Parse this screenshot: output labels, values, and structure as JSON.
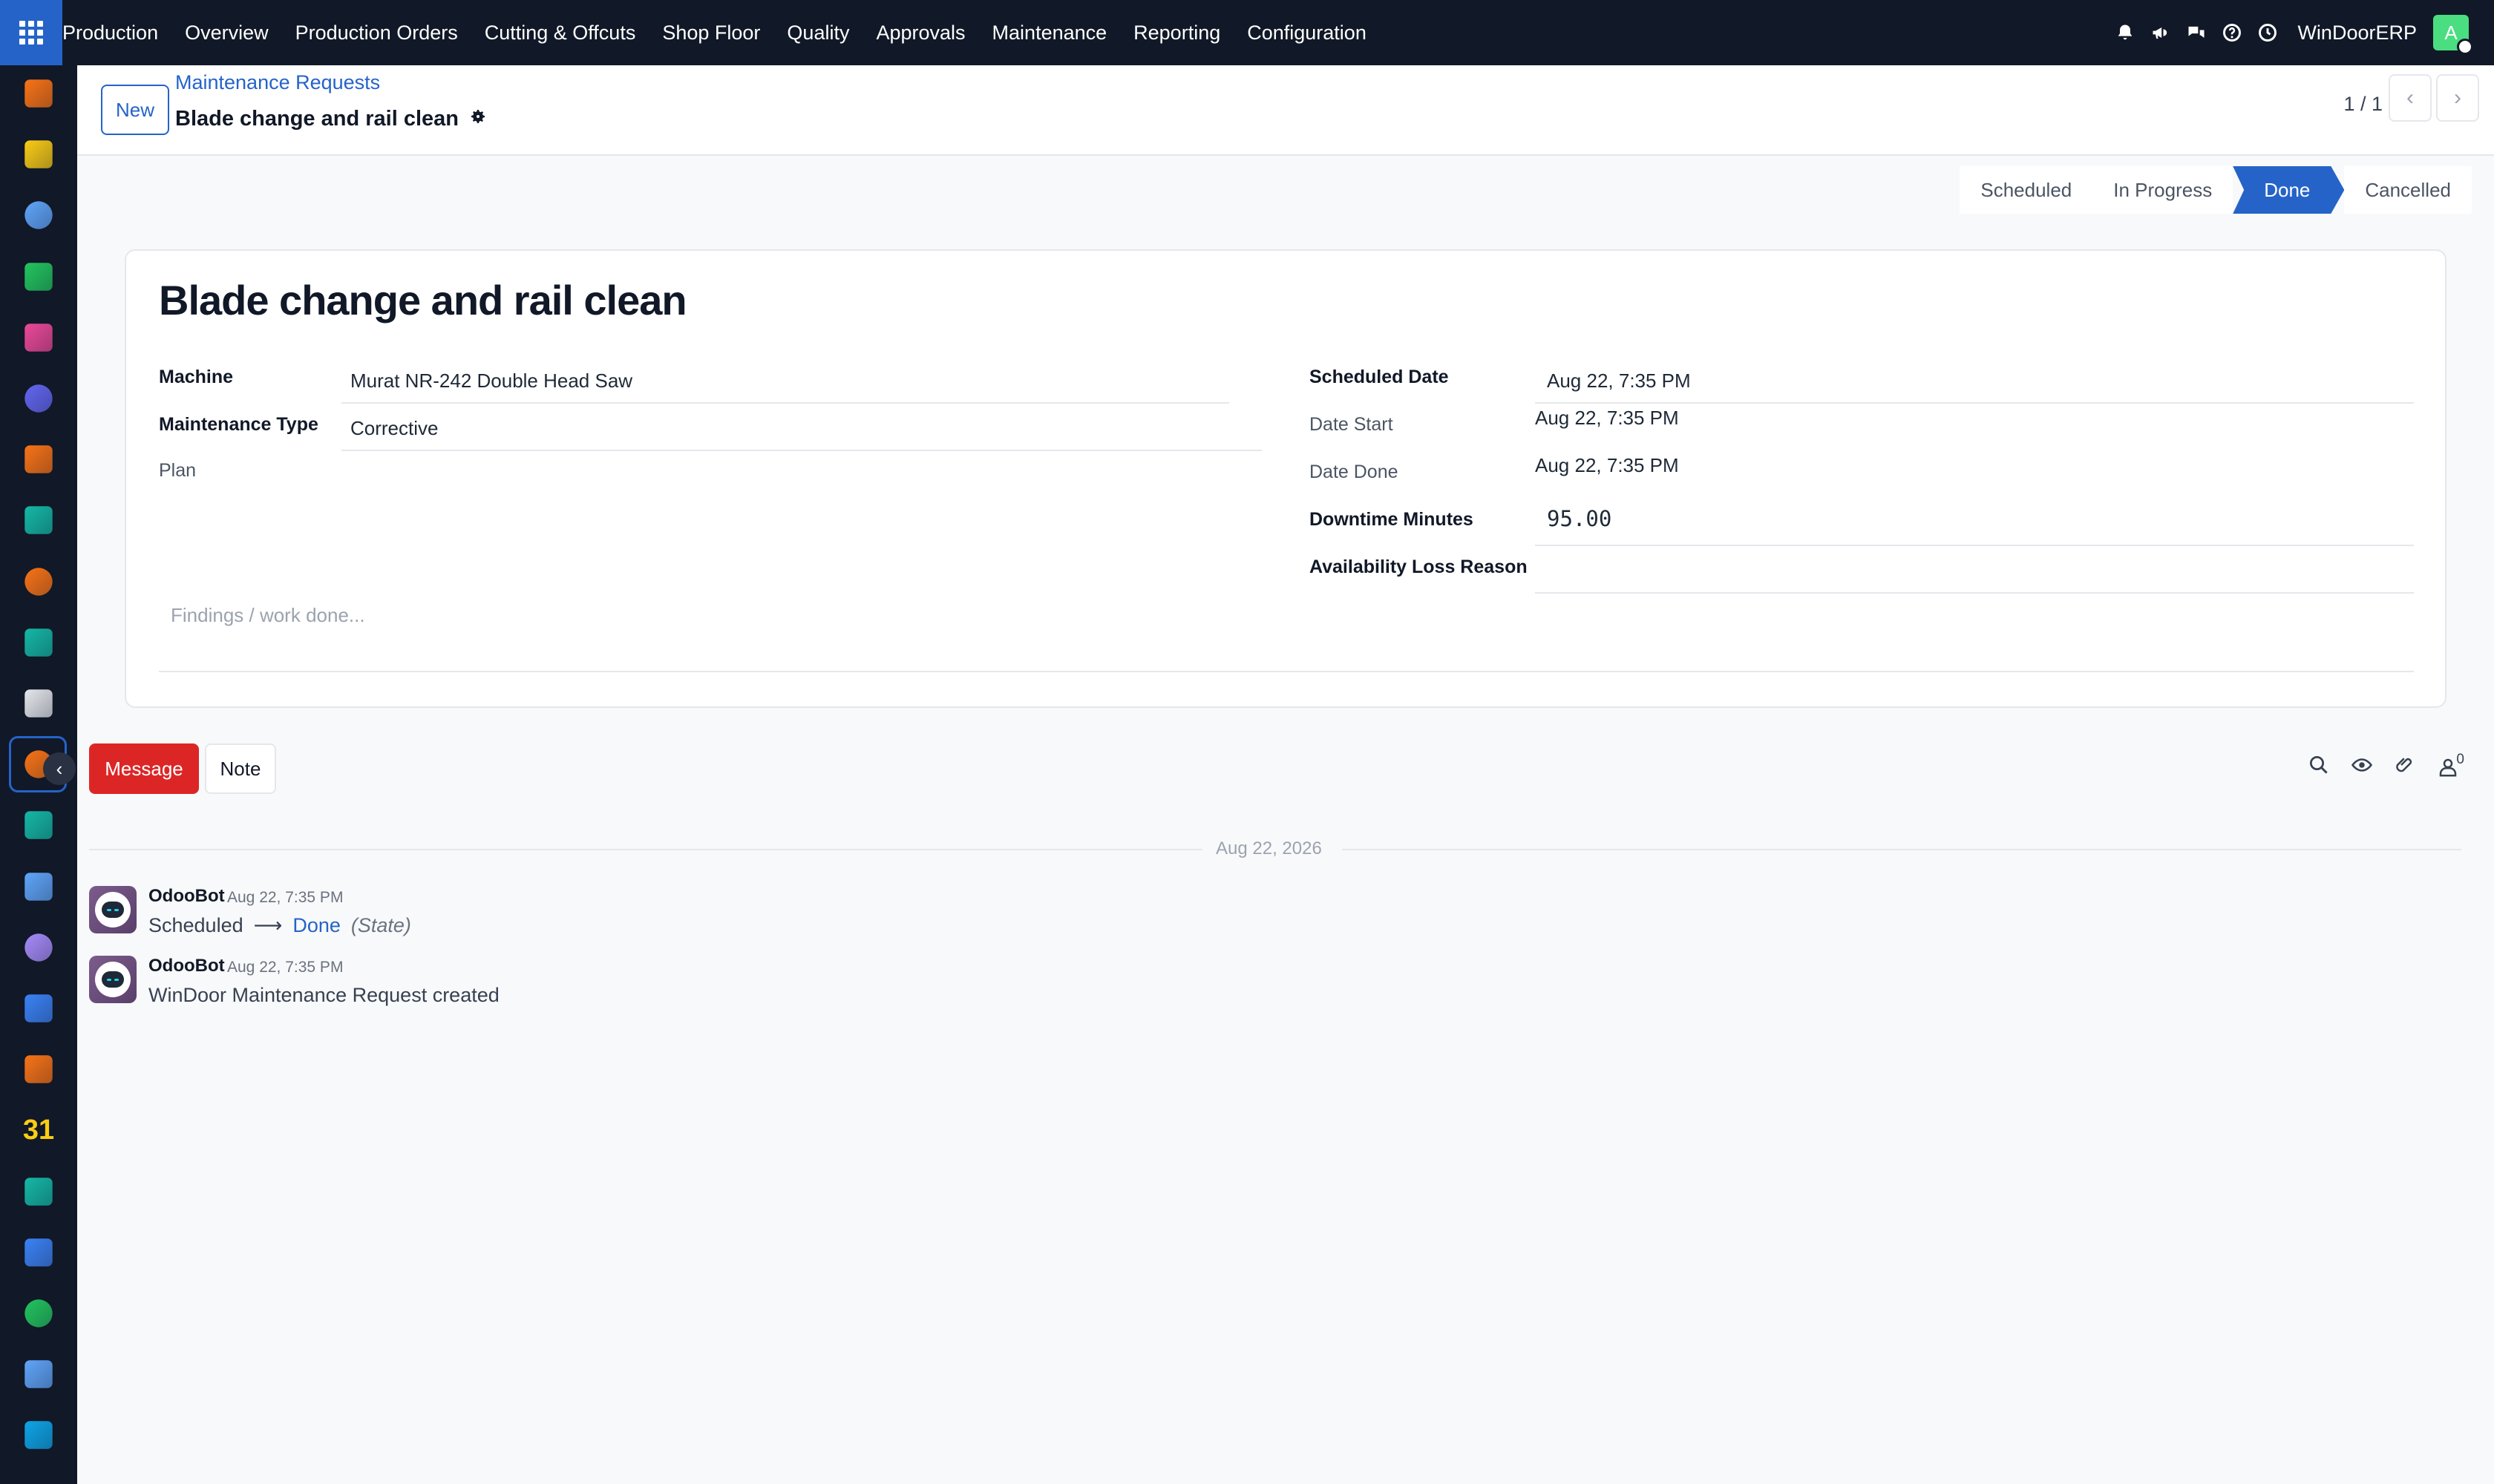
{
  "topbar": {
    "app_name": "Production",
    "menu": [
      "Overview",
      "Production Orders",
      "Cutting & Offcuts",
      "Shop Floor",
      "Quality",
      "Approvals",
      "Maintenance",
      "Reporting",
      "Configuration"
    ],
    "company": "WinDoorERP",
    "avatar_initial": "A",
    "avatar_color": "#4ade80",
    "icons": [
      "bell-icon",
      "megaphone-icon",
      "chat-bubbles-icon",
      "help-icon",
      "clock-icon"
    ]
  },
  "sidebar": {
    "apps": [
      {
        "name": "sidebar-app-bar-chart",
        "color": "#f97316"
      },
      {
        "name": "sidebar-app-paper-plane",
        "color": "#facc15"
      },
      {
        "name": "sidebar-app-dashboard-dial",
        "color": "#60a5fa"
      },
      {
        "name": "sidebar-app-whatsapp",
        "color": "#22c55e"
      },
      {
        "name": "sidebar-app-tiles",
        "color": "#ec4899"
      },
      {
        "name": "sidebar-app-mail-m",
        "color": "#6366f1"
      },
      {
        "name": "sidebar-app-chat-bubble",
        "color": "#f97316"
      },
      {
        "name": "sidebar-app-check-ribbon",
        "color": "#14b8a6"
      },
      {
        "name": "sidebar-app-bar-chart-2",
        "color": "#f97316"
      },
      {
        "name": "sidebar-app-contacts",
        "color": "#14b8a6"
      },
      {
        "name": "sidebar-app-cube",
        "color": "#e5e7eb"
      },
      {
        "name": "sidebar-app-maintenance-active",
        "color": "#f97316"
      },
      {
        "name": "sidebar-app-checkmark",
        "color": "#14b8a6"
      },
      {
        "name": "sidebar-app-book",
        "color": "#60a5fa"
      },
      {
        "name": "sidebar-app-package",
        "color": "#a78bfa"
      },
      {
        "name": "sidebar-app-dollar",
        "color": "#3b82f6"
      },
      {
        "name": "sidebar-app-team",
        "color": "#f97316"
      },
      {
        "name": "sidebar-app-calendar",
        "color": "#facc15",
        "text": "31"
      },
      {
        "name": "sidebar-app-sign",
        "color": "#14b8a6"
      },
      {
        "name": "sidebar-app-tiles-2",
        "color": "#3b82f6"
      },
      {
        "name": "sidebar-app-whatsapp-2",
        "color": "#22c55e"
      },
      {
        "name": "sidebar-app-dashboard-dial-2",
        "color": "#60a5fa"
      },
      {
        "name": "sidebar-app-waves",
        "color": "#0ea5e9"
      }
    ]
  },
  "control_panel": {
    "new_label": "New",
    "breadcrumb": "Maintenance Requests",
    "record_title": "Blade change and rail clean",
    "pager": "1 / 1"
  },
  "statusbar": {
    "stages": [
      "Scheduled",
      "In Progress",
      "Done",
      "Cancelled"
    ],
    "active": "Done",
    "active_color": "#2563c9"
  },
  "form": {
    "title": "Blade change and rail clean",
    "left": {
      "machine_label": "Machine",
      "machine_value": "Murat NR-242 Double Head Saw",
      "type_label": "Maintenance Type",
      "type_value": "Corrective",
      "plan_label": "Plan"
    },
    "right": {
      "scheduled_label": "Scheduled Date",
      "scheduled_value": "Aug 22, 7:35 PM",
      "start_label": "Date Start",
      "start_value": "Aug 22, 7:35 PM",
      "done_label": "Date Done",
      "done_value": "Aug 22, 7:35 PM",
      "downtime_label": "Downtime Minutes",
      "downtime_value": "95.00",
      "loss_label": "Availability Loss Reason",
      "loss_value": ""
    },
    "notes_placeholder": "Findings / work done..."
  },
  "chatter": {
    "message_label": "Message",
    "note_label": "Note",
    "followers_count": "0",
    "date_separator": "Aug 22, 2026",
    "messages": [
      {
        "author": "OdooBot",
        "time": "Aug 22, 7:35 PM",
        "old_value": "Scheduled",
        "arrow": "⟶",
        "new_value": "Done",
        "field": "(State)"
      },
      {
        "author": "OdooBot",
        "time": "Aug 22, 7:35 PM",
        "text": "WinDoor Maintenance Request created"
      }
    ]
  }
}
